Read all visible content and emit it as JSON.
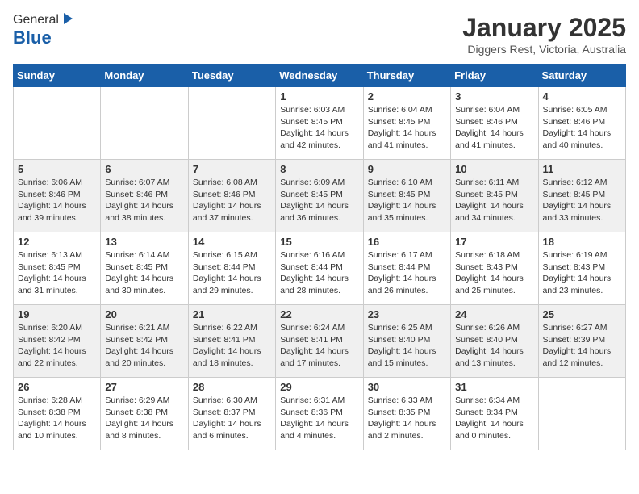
{
  "header": {
    "logo_general": "General",
    "logo_blue": "Blue",
    "month": "January 2025",
    "location": "Diggers Rest, Victoria, Australia"
  },
  "days_of_week": [
    "Sunday",
    "Monday",
    "Tuesday",
    "Wednesday",
    "Thursday",
    "Friday",
    "Saturday"
  ],
  "weeks": [
    [
      {
        "day": "",
        "info": ""
      },
      {
        "day": "",
        "info": ""
      },
      {
        "day": "",
        "info": ""
      },
      {
        "day": "1",
        "info": "Sunrise: 6:03 AM\nSunset: 8:45 PM\nDaylight: 14 hours\nand 42 minutes."
      },
      {
        "day": "2",
        "info": "Sunrise: 6:04 AM\nSunset: 8:45 PM\nDaylight: 14 hours\nand 41 minutes."
      },
      {
        "day": "3",
        "info": "Sunrise: 6:04 AM\nSunset: 8:46 PM\nDaylight: 14 hours\nand 41 minutes."
      },
      {
        "day": "4",
        "info": "Sunrise: 6:05 AM\nSunset: 8:46 PM\nDaylight: 14 hours\nand 40 minutes."
      }
    ],
    [
      {
        "day": "5",
        "info": "Sunrise: 6:06 AM\nSunset: 8:46 PM\nDaylight: 14 hours\nand 39 minutes."
      },
      {
        "day": "6",
        "info": "Sunrise: 6:07 AM\nSunset: 8:46 PM\nDaylight: 14 hours\nand 38 minutes."
      },
      {
        "day": "7",
        "info": "Sunrise: 6:08 AM\nSunset: 8:46 PM\nDaylight: 14 hours\nand 37 minutes."
      },
      {
        "day": "8",
        "info": "Sunrise: 6:09 AM\nSunset: 8:45 PM\nDaylight: 14 hours\nand 36 minutes."
      },
      {
        "day": "9",
        "info": "Sunrise: 6:10 AM\nSunset: 8:45 PM\nDaylight: 14 hours\nand 35 minutes."
      },
      {
        "day": "10",
        "info": "Sunrise: 6:11 AM\nSunset: 8:45 PM\nDaylight: 14 hours\nand 34 minutes."
      },
      {
        "day": "11",
        "info": "Sunrise: 6:12 AM\nSunset: 8:45 PM\nDaylight: 14 hours\nand 33 minutes."
      }
    ],
    [
      {
        "day": "12",
        "info": "Sunrise: 6:13 AM\nSunset: 8:45 PM\nDaylight: 14 hours\nand 31 minutes."
      },
      {
        "day": "13",
        "info": "Sunrise: 6:14 AM\nSunset: 8:45 PM\nDaylight: 14 hours\nand 30 minutes."
      },
      {
        "day": "14",
        "info": "Sunrise: 6:15 AM\nSunset: 8:44 PM\nDaylight: 14 hours\nand 29 minutes."
      },
      {
        "day": "15",
        "info": "Sunrise: 6:16 AM\nSunset: 8:44 PM\nDaylight: 14 hours\nand 28 minutes."
      },
      {
        "day": "16",
        "info": "Sunrise: 6:17 AM\nSunset: 8:44 PM\nDaylight: 14 hours\nand 26 minutes."
      },
      {
        "day": "17",
        "info": "Sunrise: 6:18 AM\nSunset: 8:43 PM\nDaylight: 14 hours\nand 25 minutes."
      },
      {
        "day": "18",
        "info": "Sunrise: 6:19 AM\nSunset: 8:43 PM\nDaylight: 14 hours\nand 23 minutes."
      }
    ],
    [
      {
        "day": "19",
        "info": "Sunrise: 6:20 AM\nSunset: 8:42 PM\nDaylight: 14 hours\nand 22 minutes."
      },
      {
        "day": "20",
        "info": "Sunrise: 6:21 AM\nSunset: 8:42 PM\nDaylight: 14 hours\nand 20 minutes."
      },
      {
        "day": "21",
        "info": "Sunrise: 6:22 AM\nSunset: 8:41 PM\nDaylight: 14 hours\nand 18 minutes."
      },
      {
        "day": "22",
        "info": "Sunrise: 6:24 AM\nSunset: 8:41 PM\nDaylight: 14 hours\nand 17 minutes."
      },
      {
        "day": "23",
        "info": "Sunrise: 6:25 AM\nSunset: 8:40 PM\nDaylight: 14 hours\nand 15 minutes."
      },
      {
        "day": "24",
        "info": "Sunrise: 6:26 AM\nSunset: 8:40 PM\nDaylight: 14 hours\nand 13 minutes."
      },
      {
        "day": "25",
        "info": "Sunrise: 6:27 AM\nSunset: 8:39 PM\nDaylight: 14 hours\nand 12 minutes."
      }
    ],
    [
      {
        "day": "26",
        "info": "Sunrise: 6:28 AM\nSunset: 8:38 PM\nDaylight: 14 hours\nand 10 minutes."
      },
      {
        "day": "27",
        "info": "Sunrise: 6:29 AM\nSunset: 8:38 PM\nDaylight: 14 hours\nand 8 minutes."
      },
      {
        "day": "28",
        "info": "Sunrise: 6:30 AM\nSunset: 8:37 PM\nDaylight: 14 hours\nand 6 minutes."
      },
      {
        "day": "29",
        "info": "Sunrise: 6:31 AM\nSunset: 8:36 PM\nDaylight: 14 hours\nand 4 minutes."
      },
      {
        "day": "30",
        "info": "Sunrise: 6:33 AM\nSunset: 8:35 PM\nDaylight: 14 hours\nand 2 minutes."
      },
      {
        "day": "31",
        "info": "Sunrise: 6:34 AM\nSunset: 8:34 PM\nDaylight: 14 hours\nand 0 minutes."
      },
      {
        "day": "",
        "info": ""
      }
    ]
  ]
}
